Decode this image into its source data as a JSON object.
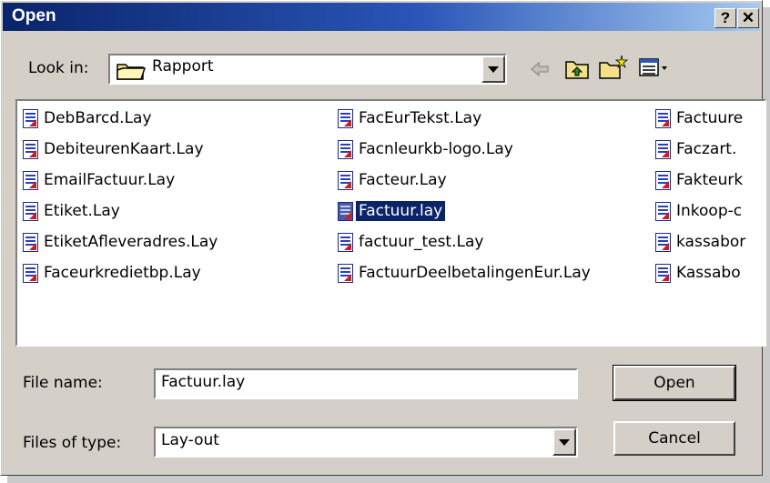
{
  "window": {
    "title": "Open",
    "help_label": "?",
    "close_label": "✕"
  },
  "look_in": {
    "label": "Look in:",
    "value": "Rapport"
  },
  "toolbar": {
    "back_icon": "back-arrow-icon",
    "up_icon": "up-folder-icon",
    "new_folder_icon": "new-folder-icon",
    "view_icon": "view-menu-icon"
  },
  "files": {
    "col1": [
      "DebBarcd.Lay",
      "DebiteurenKaart.Lay",
      "EmailFactuur.Lay",
      "Etiket.Lay",
      "EtiketAfleveradres.Lay",
      "Faceurkredietbp.Lay"
    ],
    "col2": [
      "FacEurTekst.Lay",
      "Facnleurkb-logo.Lay",
      "Facteur.Lay",
      "Factuur.lay",
      "factuur_test.Lay",
      "FactuurDeelbetalingenEur.Lay"
    ],
    "col3": [
      "Factuure",
      "Faczart.",
      "Fakteurk",
      "Inkoop-c",
      "kassabor",
      "Kassabo"
    ],
    "selected": "Factuur.lay"
  },
  "file_name": {
    "label": "File name:",
    "value": "Factuur.lay"
  },
  "file_type": {
    "label": "Files of type:",
    "value": "Lay-out"
  },
  "buttons": {
    "open": "Open",
    "cancel": "Cancel"
  },
  "colors": {
    "title_start": "#0a246a",
    "title_end": "#a6caf0",
    "face": "#d4d0c8",
    "selection": "#0a246a"
  }
}
